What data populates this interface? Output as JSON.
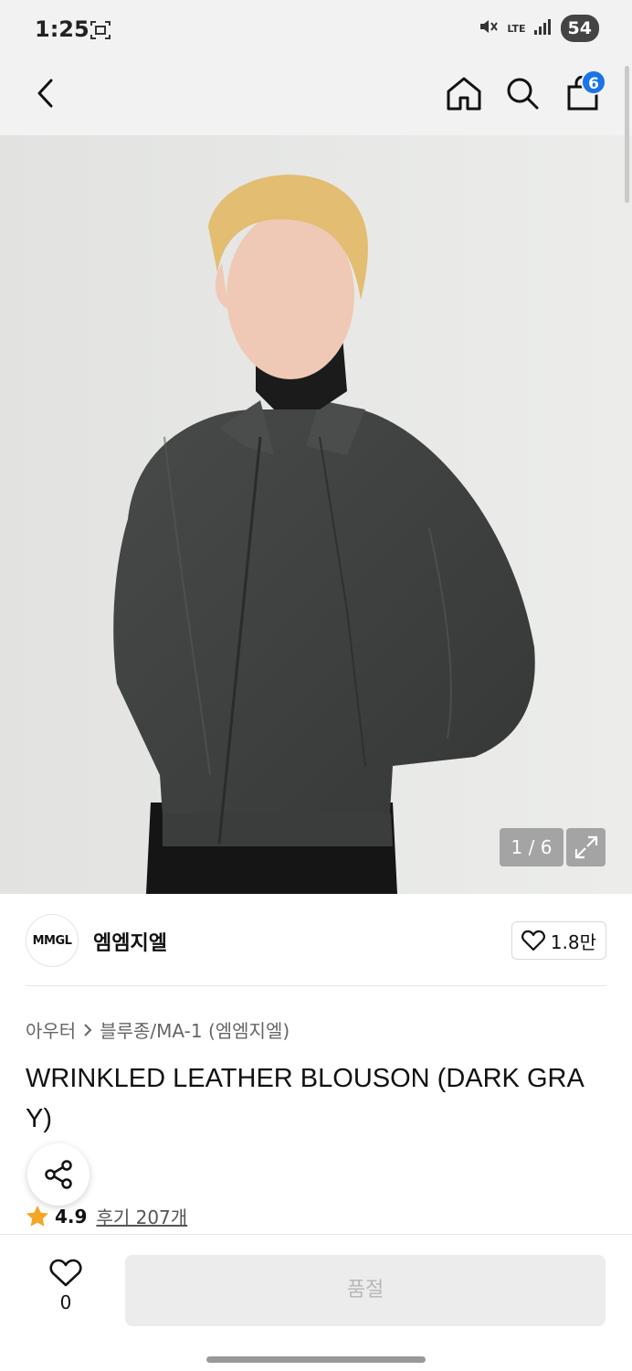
{
  "status": {
    "time": "1:25",
    "battery": "54",
    "network": "LTE"
  },
  "nav": {
    "cart_count": "6"
  },
  "gallery": {
    "counter": "1 / 6"
  },
  "brand": {
    "logo_text": "MMGL",
    "name": "엠엠지엘",
    "likes": "1.8만"
  },
  "breadcrumb": {
    "category": "아우터",
    "subcategory": "블루종/MA-1 (엠엠지엘)"
  },
  "product": {
    "title": "WRINKLED LEATHER BLOUSON (DARK GRAY)"
  },
  "rating": {
    "value": "4.9",
    "reviews": "후기 207개"
  },
  "bottom": {
    "wish_count": "0",
    "cta_label": "품절"
  },
  "colors": {
    "badge": "#1a73e8",
    "star": "#f5a623",
    "jacket": "#3d403f"
  }
}
